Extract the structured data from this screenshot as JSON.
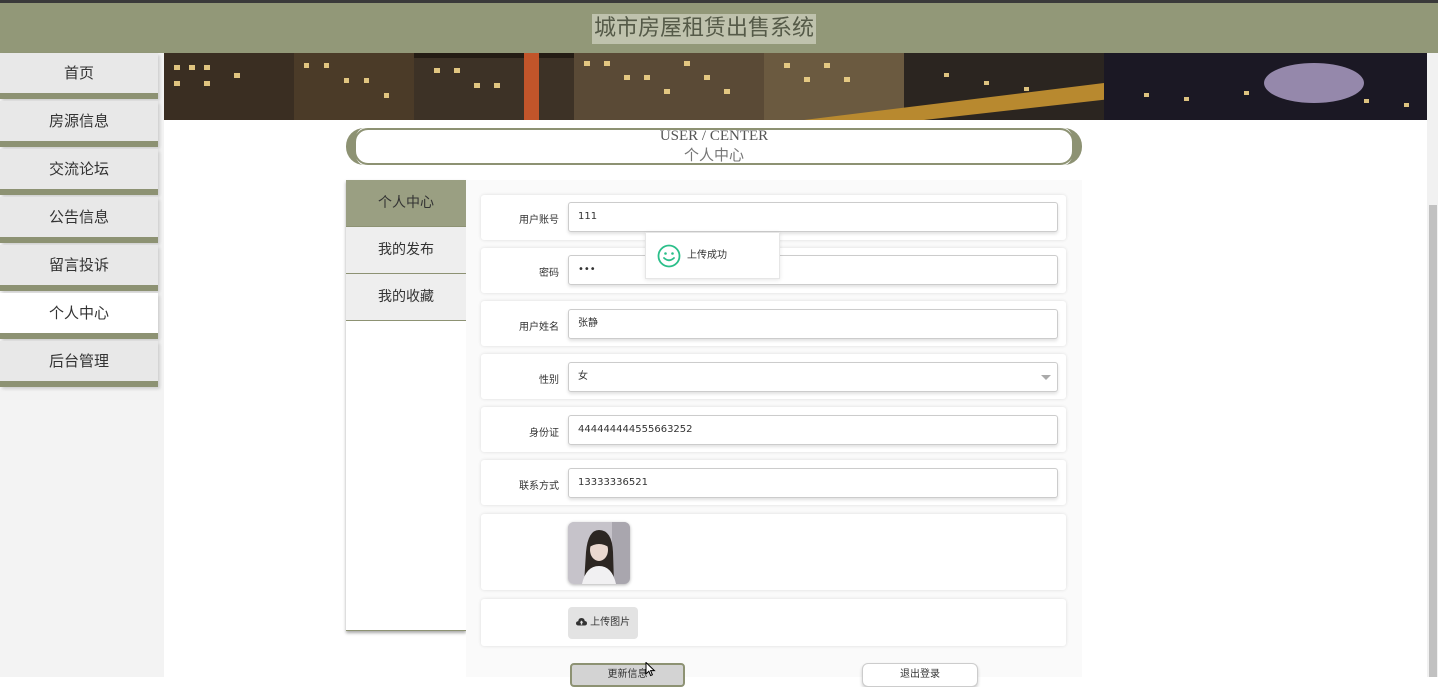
{
  "header": {
    "title": "城市房屋租赁出售系统"
  },
  "sidebar": {
    "items": [
      {
        "label": "首页"
      },
      {
        "label": "房源信息"
      },
      {
        "label": "交流论坛"
      },
      {
        "label": "公告信息"
      },
      {
        "label": "留言投诉"
      },
      {
        "label": "个人中心",
        "active": true
      },
      {
        "label": "后台管理"
      }
    ]
  },
  "user_center": {
    "title_en": "USER / CENTER",
    "title_cn": "个人中心",
    "menu": [
      {
        "label": "个人中心",
        "active": true
      },
      {
        "label": "我的发布"
      },
      {
        "label": "我的收藏"
      }
    ]
  },
  "form": {
    "account": {
      "label": "用户账号",
      "value": "111"
    },
    "password": {
      "label": "密码",
      "value": "•••"
    },
    "name": {
      "label": "用户姓名",
      "value": "张静"
    },
    "gender": {
      "label": "性别",
      "value": "女"
    },
    "id_card": {
      "label": "身份证",
      "value": "444444444555663252"
    },
    "phone": {
      "label": "联系方式",
      "value": "13333336521"
    },
    "upload_label": "上传图片",
    "update_button": "更新信息",
    "logout_button": "退出登录"
  },
  "toast": {
    "message": "上传成功"
  },
  "colors": {
    "accent": "#8d9273",
    "header": "#929878",
    "success_icon": "#2bbf8a"
  }
}
